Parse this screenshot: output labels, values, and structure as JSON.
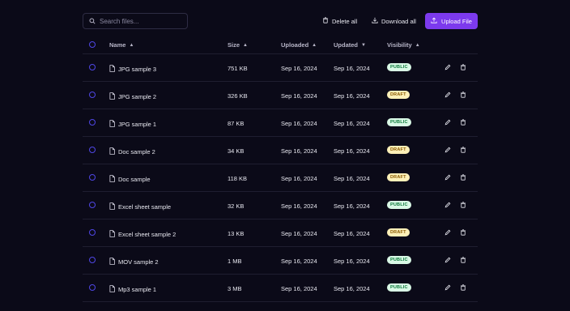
{
  "colors": {
    "accent": "#7c3aed",
    "public_bg": "#d9f9e6",
    "draft_bg": "#fdf0b8"
  },
  "search": {
    "placeholder": "Search files..."
  },
  "toolbar": {
    "delete_label": "Delete all",
    "download_label": "Download all",
    "upload_label": "Upload File"
  },
  "columns": {
    "name": "Name",
    "size": "Size",
    "uploaded": "Uploaded",
    "updated": "Updated",
    "visibility": "Visibility"
  },
  "files": [
    {
      "icon": "image-file-icon",
      "name": "JPG sample 3",
      "size": "751 KB",
      "uploaded": "Sep 16, 2024",
      "updated": "Sep 16, 2024",
      "visibility": "PUBLIC"
    },
    {
      "icon": "image-file-icon",
      "name": "JPG sample 2",
      "size": "326 KB",
      "uploaded": "Sep 16, 2024",
      "updated": "Sep 16, 2024",
      "visibility": "DRAFT"
    },
    {
      "icon": "image-file-icon",
      "name": "JPG sample 1",
      "size": "87 KB",
      "uploaded": "Sep 16, 2024",
      "updated": "Sep 16, 2024",
      "visibility": "PUBLIC"
    },
    {
      "icon": "doc-file-icon",
      "name": "Doc sample 2",
      "size": "34 KB",
      "uploaded": "Sep 16, 2024",
      "updated": "Sep 16, 2024",
      "visibility": "DRAFT"
    },
    {
      "icon": "doc-file-icon",
      "name": "Doc sample",
      "size": "118 KB",
      "uploaded": "Sep 16, 2024",
      "updated": "Sep 16, 2024",
      "visibility": "DRAFT"
    },
    {
      "icon": "spreadsheet-file-icon",
      "name": "Excel sheet sample",
      "size": "32 KB",
      "uploaded": "Sep 16, 2024",
      "updated": "Sep 16, 2024",
      "visibility": "PUBLIC"
    },
    {
      "icon": "spreadsheet-file-icon",
      "name": "Excel sheet sample 2",
      "size": "13 KB",
      "uploaded": "Sep 16, 2024",
      "updated": "Sep 16, 2024",
      "visibility": "DRAFT"
    },
    {
      "icon": "video-file-icon",
      "name": "MOV sample 2",
      "size": "1 MB",
      "uploaded": "Sep 16, 2024",
      "updated": "Sep 16, 2024",
      "visibility": "PUBLIC"
    },
    {
      "icon": "audio-file-icon",
      "name": "Mp3 sample 1",
      "size": "3 MB",
      "uploaded": "Sep 16, 2024",
      "updated": "Sep 16, 2024",
      "visibility": "PUBLIC"
    }
  ]
}
